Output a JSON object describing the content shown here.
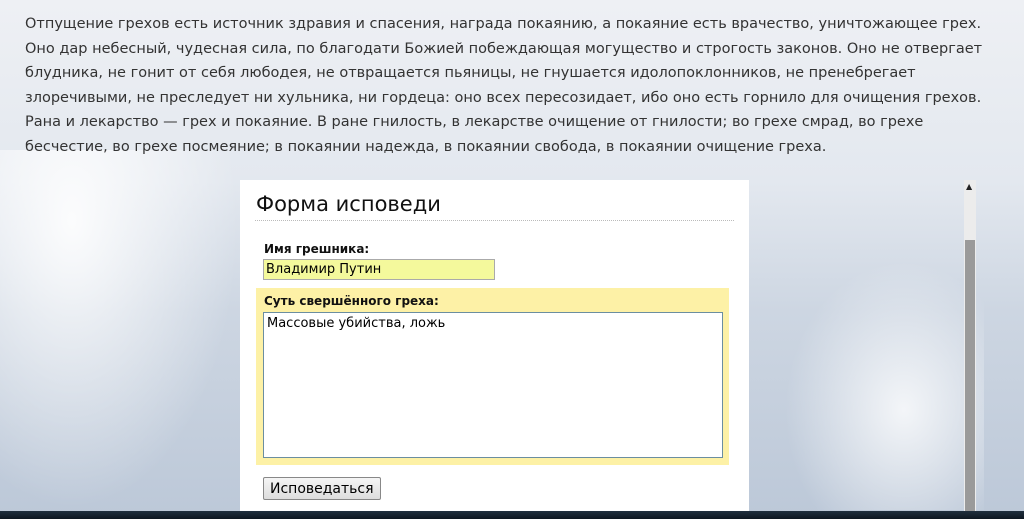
{
  "intro": {
    "paragraph1": "Отпущение грехов есть источник здравия и спасения, награда покаянию, а покаяние есть врачество, уничтожающее грех. Оно дар небесный, чудесная сила, по благодати Божией побеждающая могущество и строгость законов. Оно не отвергает блудника, не гонит от себя любодея, не отвращается пьяницы, не гнушается идолопоклонников, не пренебрегает злоречивыми, не преследует ни хульника, ни гордеца: оно всех пересозидает, ибо оно есть горнило для очищения грехов.",
    "paragraph2": "Рана и лекарство — грех и покаяние. В ране гнилость, в лекарстве очищение от гнилости; во грехе смрад, во грехе бесчестие, во грехе посмеяние; в покаянии надежда, в покаянии свобода, в покаянии очищение греха."
  },
  "form": {
    "title": "Форма исповеди",
    "name_label": "Имя грешника:",
    "name_value": "Владимир Путин",
    "sin_label": "Суть свершённого греха:",
    "sin_value": "Массовые убийства, ложь",
    "submit_label": "Исповедаться"
  }
}
